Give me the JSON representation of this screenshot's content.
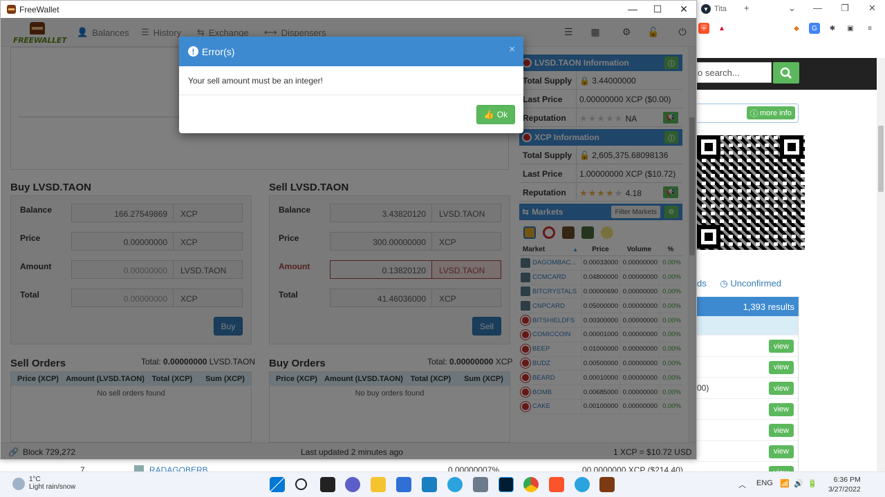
{
  "browser": {
    "tab_title": "Tita",
    "search_placeholder": "o search...",
    "more_info_label": "more info",
    "link_left": "ds",
    "link_unconfirmed": "Unconfirmed",
    "results_label": "1,393 results",
    "row_partial_text": "00)",
    "view_label": "view",
    "bottom_row": {
      "num": "7",
      "name": "RADAGOBERB",
      "pct": "0.00000007%",
      "val": "00.0000000 XCP ($214.40)"
    }
  },
  "app": {
    "title": "FreeWallet",
    "logo_text": "FREEWALLET"
  },
  "nav": {
    "balances": "Balances",
    "history": "History",
    "exchange": "Exchange",
    "dispensers": "Dispensers"
  },
  "buy": {
    "title": "Buy LVSD.TAON",
    "balance_label": "Balance",
    "balance_value": "166.27549869",
    "balance_unit": "XCP",
    "price_label": "Price",
    "price_value": "0.00000000",
    "price_unit": "XCP",
    "amount_label": "Amount",
    "amount_placeholder": "0.00000000",
    "amount_unit": "LVSD.TAON",
    "total_label": "Total",
    "total_placeholder": "0.00000000",
    "total_unit": "XCP",
    "button": "Buy"
  },
  "sell": {
    "title": "Sell LVSD.TAON",
    "balance_label": "Balance",
    "balance_value": "3.43820120",
    "balance_unit": "LVSD.TAON",
    "price_label": "Price",
    "price_value": "300.00000000",
    "price_unit": "XCP",
    "amount_label": "Amount",
    "amount_value": "0.13820120",
    "amount_unit": "LVSD.TAON",
    "total_label": "Total",
    "total_value": "41.46036000",
    "total_unit": "XCP",
    "button": "Sell"
  },
  "sell_orders": {
    "title": "Sell Orders",
    "total_prefix": "Total:",
    "total_value": "0.00000000",
    "total_unit": "LVSD.TAON",
    "columns": [
      "Price (XCP)",
      "Amount (LVSD.TAON)",
      "Total (XCP)",
      "Sum (XCP)"
    ],
    "empty": "No sell orders found"
  },
  "buy_orders": {
    "title": "Buy Orders",
    "total_prefix": "Total:",
    "total_value": "0.00000000",
    "total_unit": "XCP",
    "columns": [
      "Price (XCP)",
      "Amount (LVSD.TAON)",
      "Total (XCP)",
      "Sum (XCP)"
    ],
    "empty": "No buy orders found"
  },
  "asset_info": {
    "title": "LVSD.TAON Information",
    "supply_label": "Total Supply",
    "supply_value": "3.44000000",
    "last_label": "Last Price",
    "last_value": "0.00000000 XCP ($0.00)",
    "rep_label": "Reputation",
    "rep_value": "NA",
    "rep_stars": 0
  },
  "xcp_info": {
    "title": "XCP Information",
    "supply_label": "Total Supply",
    "supply_value": "2,605,375.68098136",
    "last_label": "Last Price",
    "last_value": "1.00000000 XCP ($10.72)",
    "rep_label": "Reputation",
    "rep_value": "4.18",
    "rep_stars": 4
  },
  "markets": {
    "title": "Markets",
    "filter_label": "Filter Markets",
    "columns": [
      "Market",
      "Price",
      "Volume",
      "%"
    ],
    "rows": [
      {
        "name": "DAGOMBAC...",
        "price": "0.00033000",
        "volume": "0.00000000",
        "pct": "0.00%"
      },
      {
        "name": "CCMCARD",
        "price": "0.04800000",
        "volume": "0.00000000",
        "pct": "0.00%"
      },
      {
        "name": "BITCRYSTALS",
        "price": "0.00000690",
        "volume": "0.00000000",
        "pct": "0.00%"
      },
      {
        "name": "CNPCARD",
        "price": "0.05000000",
        "volume": "0.00000000",
        "pct": "0.00%"
      },
      {
        "name": "BITSHIELDFS",
        "price": "0.00300000",
        "volume": "0.00000000",
        "pct": "0.00%"
      },
      {
        "name": "COMICCOIN",
        "price": "0.00001000",
        "volume": "0.00000000",
        "pct": "0.00%"
      },
      {
        "name": "BEEP",
        "price": "0.01000000",
        "volume": "0.00000000",
        "pct": "0.00%"
      },
      {
        "name": "BUDZ",
        "price": "0.00500000",
        "volume": "0.00000000",
        "pct": "0.00%"
      },
      {
        "name": "BEARD",
        "price": "0.00010000",
        "volume": "0.00000000",
        "pct": "0.00%"
      },
      {
        "name": "BOMB",
        "price": "0.00685000",
        "volume": "0.00000000",
        "pct": "0.00%"
      },
      {
        "name": "CAKE",
        "price": "0.00100000",
        "volume": "0.00000000",
        "pct": "0.00%"
      }
    ]
  },
  "status": {
    "block": "Block 729,272",
    "updated": "Last updated 2 minutes ago",
    "rate": "1 XCP = $10.72 USD"
  },
  "modal": {
    "title": "Error(s)",
    "message": "Your sell amount must be an integer!",
    "ok_label": "Ok",
    "close": "×"
  },
  "taskbar": {
    "temp": "1°C",
    "weather": "Light rain/snow",
    "lang": "ENG",
    "time": "6:36 PM",
    "date": "3/27/2022"
  },
  "colors": {
    "primary": "#337ab7",
    "header_blue": "#3e8ad0",
    "success": "#5cb85c",
    "danger": "#a94442",
    "danger_bg": "#f2dede"
  }
}
